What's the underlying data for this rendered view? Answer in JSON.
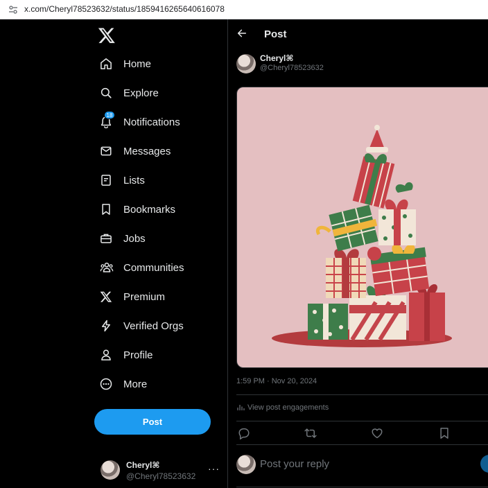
{
  "browser": {
    "url": "x.com/Cheryl78523632/status/1859416265640616078"
  },
  "nav": {
    "items": [
      {
        "label": "Home",
        "icon": "home-icon"
      },
      {
        "label": "Explore",
        "icon": "search-icon"
      },
      {
        "label": "Notifications",
        "icon": "bell-icon",
        "badge": "18"
      },
      {
        "label": "Messages",
        "icon": "envelope-icon"
      },
      {
        "label": "Lists",
        "icon": "list-icon"
      },
      {
        "label": "Bookmarks",
        "icon": "bookmark-icon"
      },
      {
        "label": "Jobs",
        "icon": "briefcase-icon"
      },
      {
        "label": "Communities",
        "icon": "people-icon"
      },
      {
        "label": "Premium",
        "icon": "x-logo-icon"
      },
      {
        "label": "Verified Orgs",
        "icon": "lightning-icon"
      },
      {
        "label": "Profile",
        "icon": "person-icon"
      },
      {
        "label": "More",
        "icon": "more-circle-icon"
      }
    ],
    "post_label": "Post"
  },
  "account": {
    "name": "Cheryl⌘",
    "handle": "@Cheryl78523632",
    "more": "···"
  },
  "post": {
    "page_title": "Post",
    "author_name": "Cheryl⌘",
    "author_handle": "@Cheryl78523632",
    "timestamp": "1:59 PM · Nov 20, 2024",
    "engagements_label": "View post engagements",
    "reply_placeholder": "Post your reply"
  },
  "colors": {
    "accent": "#1d9bf0",
    "background": "#000000",
    "text": "#e7e9ea",
    "muted": "#71767b",
    "media_bg": "#e4bfc1"
  }
}
